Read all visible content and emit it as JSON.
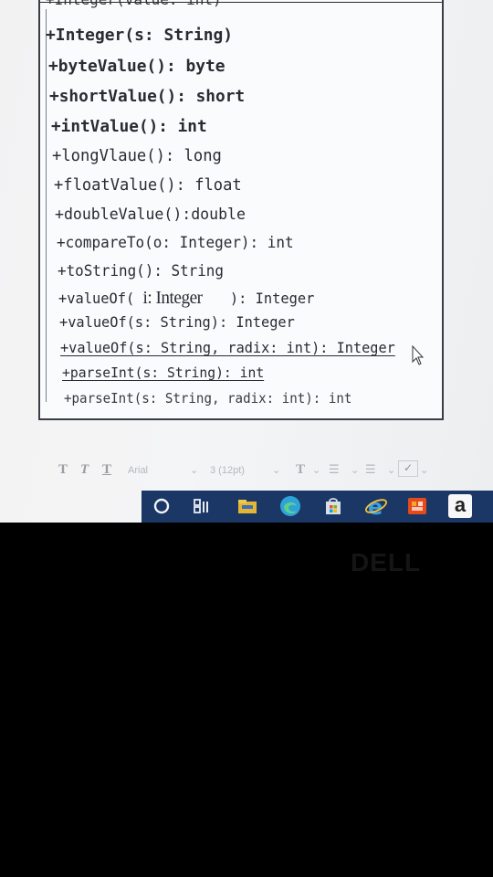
{
  "diagram": {
    "cut_top_line": "+Integer(value: int)",
    "methods": [
      "+Integer(s: String)",
      "+byteValue(): byte",
      "+shortValue(): short",
      "+intValue(): int",
      "+longVlaue(): long",
      "+floatValue(): float",
      "+doubleValue():double",
      "+compareTo(o: Integer): int",
      "+toString(): String"
    ],
    "value_of_integer": {
      "prefix": "+valueOf(",
      "param": "i: Integer",
      "suffix": "): Integer"
    },
    "methods_after": [
      "+valueOf(s: String): Integer",
      "+valueOf(s: String, radix: int): Integer",
      "+parseInt(s: String): int",
      "+parseInt(s: String, radix: int): int"
    ]
  },
  "toolbar": {
    "style_glyphs": [
      "T",
      "T",
      "T"
    ],
    "font_name": "Arial",
    "font_size": "3 (12pt)",
    "text_color_glyph": "T"
  },
  "taskbar": {
    "icons": [
      "search-circle-icon",
      "task-view-icon",
      "file-explorer-icon",
      "edge-icon",
      "store-icon",
      "internet-explorer-icon",
      "office-icon",
      "amazon-icon"
    ],
    "amazon_letter": "a"
  },
  "bezel": {
    "brand": "DELL"
  },
  "colors": {
    "screen_bg": "#f3f3f4",
    "taskbar_bg": "#1b3766",
    "text": "#2a2b33",
    "bezel": "#000000"
  }
}
